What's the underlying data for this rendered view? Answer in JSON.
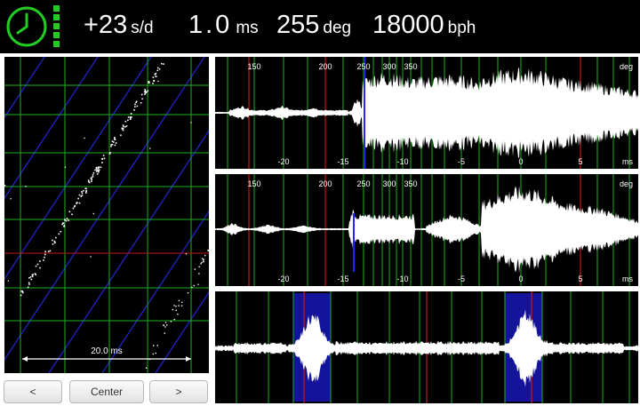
{
  "header": {
    "rate": {
      "value": "+23",
      "unit": "s/d"
    },
    "beat_error": {
      "value": "1.0",
      "unit": "ms"
    },
    "amplitude": {
      "value": "255",
      "unit": "deg"
    },
    "beat_rate": {
      "value": "18000",
      "unit": "bph"
    }
  },
  "paper_strip": {
    "scale_label": "20.0 ms"
  },
  "waveforms": {
    "deg_ticks": [
      "150",
      "200",
      "250",
      "300",
      "350"
    ],
    "deg_unit": "deg",
    "ms_ticks": [
      "-20",
      "-15",
      "-10",
      "-5",
      "0",
      "5"
    ],
    "ms_unit": "ms"
  },
  "buttons": {
    "prev": "<",
    "center": "Center",
    "next": ">"
  },
  "colors": {
    "status_green": "#22cc22",
    "grid_green": "#1fae1f",
    "marker_red": "#c01818",
    "diag_blue": "#2323c8",
    "highlight_blue": "#14149a"
  }
}
